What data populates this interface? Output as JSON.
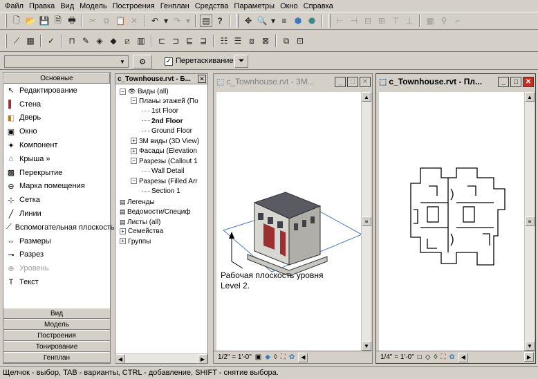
{
  "menu": [
    "Файл",
    "Правка",
    "Вид",
    "Модель",
    "Построения",
    "Генплан",
    "Средства",
    "Параметры",
    "Окно",
    "Справка"
  ],
  "options_bar": {
    "drag_label": "Перетаскивание",
    "drag_checked": true
  },
  "design_bar": {
    "header": "Основные",
    "tools": [
      {
        "label": "Редактирование",
        "icon": "pointer-icon"
      },
      {
        "label": "Стена",
        "icon": "wall-icon"
      },
      {
        "label": "Дверь",
        "icon": "door-icon"
      },
      {
        "label": "Окно",
        "icon": "window-icon"
      },
      {
        "label": "Компонент",
        "icon": "component-icon"
      },
      {
        "label": "Крыша »",
        "icon": "roof-icon"
      },
      {
        "label": "Перекрытие",
        "icon": "floor-icon"
      },
      {
        "label": "Марка помещения",
        "icon": "room-tag-icon"
      },
      {
        "label": "Сетка",
        "icon": "grid-icon"
      },
      {
        "label": "Линии",
        "icon": "lines-icon"
      },
      {
        "label": "Вспомогательная плоскость",
        "icon": "ref-plane-icon"
      },
      {
        "label": "Размеры",
        "icon": "dimension-icon"
      },
      {
        "label": "Разрез",
        "icon": "section-icon"
      },
      {
        "label": "Уровень",
        "icon": "level-icon"
      },
      {
        "label": "Текст",
        "icon": "text-icon"
      }
    ],
    "tabs": [
      "Вид",
      "Модель",
      "Построения",
      "Тонирование",
      "Генплан"
    ]
  },
  "browser": {
    "title": "c_Townhouse.rvt - Б...",
    "items": [
      {
        "label": "Виды (all)",
        "level": 0,
        "toggle": "−",
        "bold": false
      },
      {
        "label": "Планы этажей (По",
        "level": 1,
        "toggle": "−",
        "bold": false
      },
      {
        "label": "1st Floor",
        "level": 2,
        "toggle": "",
        "bold": false
      },
      {
        "label": "2nd Floor",
        "level": 2,
        "toggle": "",
        "bold": true
      },
      {
        "label": "Ground Floor",
        "level": 2,
        "toggle": "",
        "bold": false
      },
      {
        "label": "3М виды (3D View)",
        "level": 1,
        "toggle": "+",
        "bold": false
      },
      {
        "label": "Фасады (Elevation",
        "level": 1,
        "toggle": "+",
        "bold": false
      },
      {
        "label": "Разрезы (Callout 1",
        "level": 1,
        "toggle": "−",
        "bold": false
      },
      {
        "label": "Wall Detail",
        "level": 2,
        "toggle": "",
        "bold": false
      },
      {
        "label": "Разрезы (Filled Arr",
        "level": 1,
        "toggle": "−",
        "bold": false
      },
      {
        "label": "Section 1",
        "level": 2,
        "toggle": "",
        "bold": false
      },
      {
        "label": "Легенды",
        "level": 0,
        "toggle": "",
        "bold": false
      },
      {
        "label": "Ведомости/Специф",
        "level": 0,
        "toggle": "",
        "bold": false
      },
      {
        "label": "Листы (all)",
        "level": 0,
        "toggle": "",
        "bold": false
      },
      {
        "label": "Семейства",
        "level": 0,
        "toggle": "+",
        "bold": false
      },
      {
        "label": "Группы",
        "level": 0,
        "toggle": "+",
        "bold": false
      }
    ]
  },
  "view3d": {
    "title": "c_Townhouse.rvt - 3М...",
    "annotation_line1": "Рабочая плоскость уровня",
    "annotation_line2": "Level 2.",
    "scale": "1/2\" = 1'-0\""
  },
  "viewplan": {
    "title": "c_Townhouse.rvt - Пл...",
    "scale": "1/4\" = 1'-0\""
  },
  "status_text": "Щелчок - выбор, TAB - варианты, CTRL - добавление, SHIFT - снятие выбора.",
  "colors": {
    "workplane": "#4a7ab8",
    "roof": "#5a5a62",
    "brick": "#9c3030",
    "active_close": "#c03020"
  }
}
